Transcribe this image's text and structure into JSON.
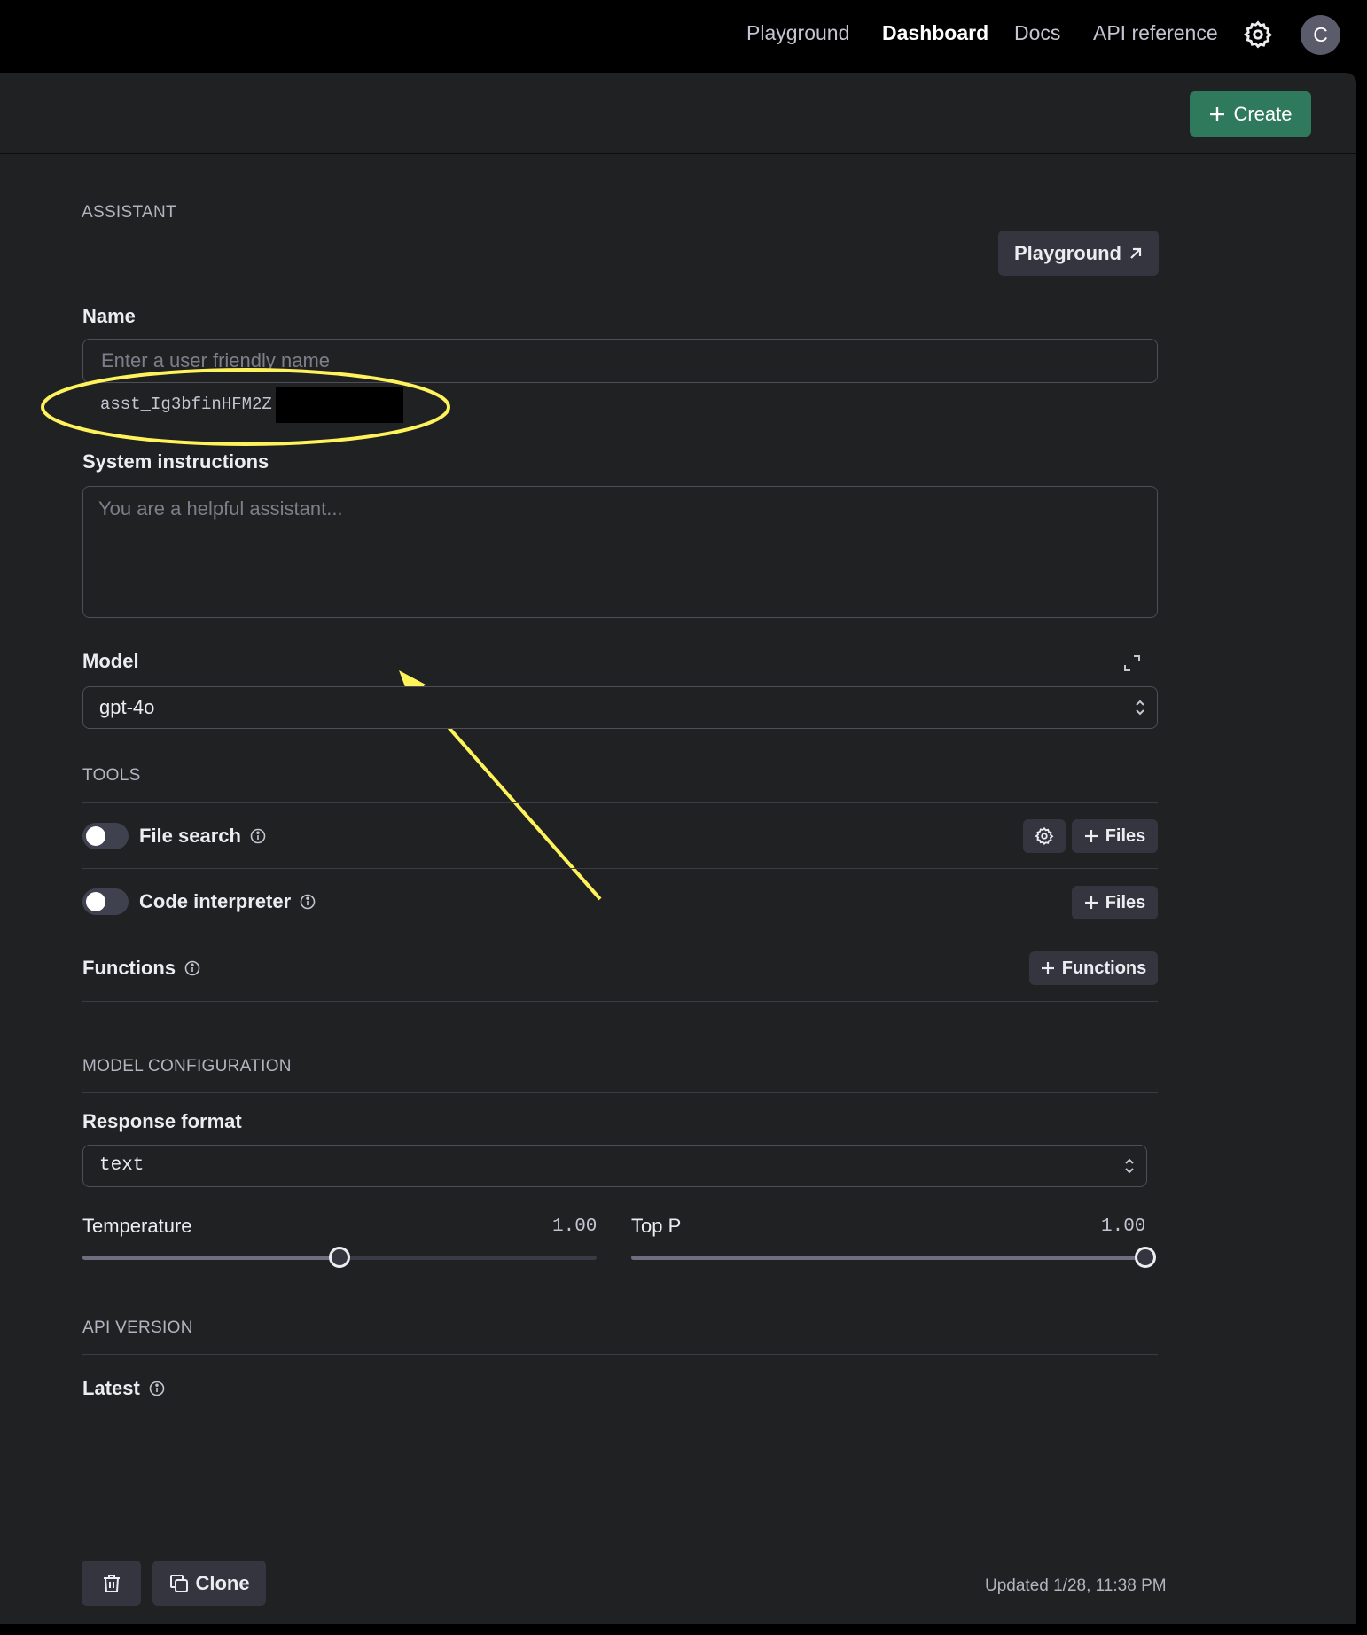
{
  "nav": {
    "links": [
      "Playground",
      "Dashboard",
      "Docs",
      "API reference"
    ],
    "active": "Dashboard",
    "avatar_initial": "C"
  },
  "toolbar": {
    "create_label": "Create"
  },
  "assistant": {
    "section_heading": "ASSISTANT",
    "playground_label": "Playground",
    "name_label": "Name",
    "name_placeholder": "Enter a user friendly name",
    "assistant_id": "asst_Ig3bfinHFM2Z",
    "instructions_label": "System instructions",
    "instructions_placeholder": "You are a helpful assistant...",
    "model_label": "Model",
    "model_value": "gpt-4o"
  },
  "tools": {
    "section_heading": "TOOLS",
    "file_search_label": "File search",
    "file_search_enabled": false,
    "code_interpreter_label": "Code interpreter",
    "code_interpreter_enabled": false,
    "functions_label": "Functions",
    "files_button_label": "Files",
    "functions_button_label": "Functions"
  },
  "model_config": {
    "section_heading": "MODEL CONFIGURATION",
    "response_format_label": "Response format",
    "response_format_value": "text",
    "temperature_label": "Temperature",
    "temperature_value": "1.00",
    "temperature_fraction": 0.5,
    "top_p_label": "Top P",
    "top_p_value": "1.00",
    "top_p_fraction": 1.0
  },
  "api_version": {
    "section_heading": "API VERSION",
    "value": "Latest"
  },
  "footer": {
    "clone_label": "Clone",
    "updated_text": "Updated 1/28, 11:38 PM"
  },
  "colors": {
    "accent_green": "#2f7a5c",
    "annotation_yellow": "#fff35c",
    "panel_bg": "#202123"
  }
}
